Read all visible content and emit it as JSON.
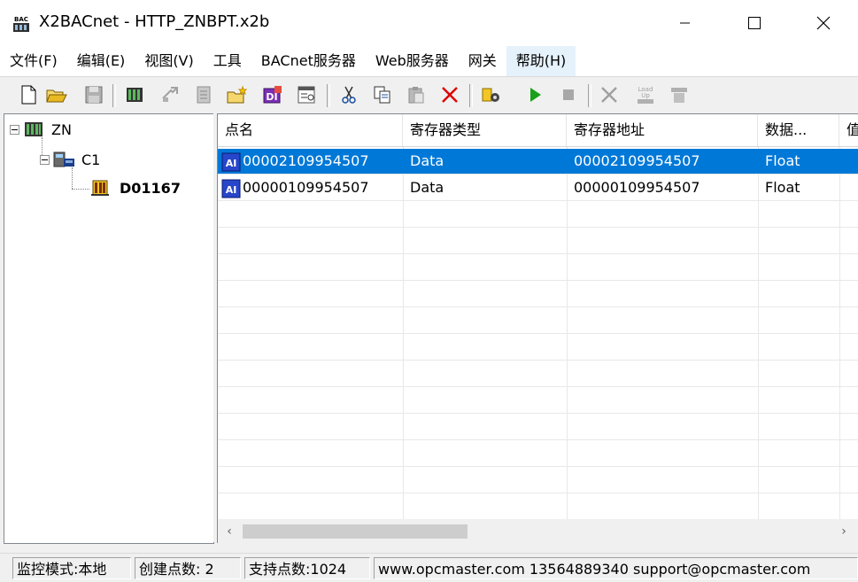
{
  "window": {
    "title": "X2BACnet - HTTP_ZNBPT.x2b",
    "minimize_icon": "minimize-icon",
    "maximize_icon": "maximize-icon",
    "close_icon": "close-icon"
  },
  "menu": {
    "items": [
      "文件(F)",
      "编辑(E)",
      "视图(V)",
      "工具",
      "BACnet服务器",
      "Web服务器",
      "网关",
      "帮助(H)"
    ]
  },
  "toolbar": {
    "icons": [
      "new-file-icon",
      "open-folder-icon",
      "save-icon",
      "device-icon",
      "export-icon",
      "list-icon",
      "add-folder-icon",
      "data-icon",
      "properties-icon",
      "cut-icon",
      "copy-icon",
      "paste-icon",
      "delete-icon",
      "config-icon",
      "run-icon",
      "stop-icon",
      "tools-icon",
      "load-up-icon",
      "download-icon"
    ],
    "load_up_label": "Load Up"
  },
  "tree": {
    "root": {
      "label": "ZN"
    },
    "child": {
      "label": "C1"
    },
    "leaf": {
      "label": "D01167"
    }
  },
  "list": {
    "columns": [
      "点名",
      "寄存器类型",
      "寄存器地址",
      "数据...",
      "值"
    ],
    "rows": [
      {
        "icon_text": "AI",
        "name": "00002109954507",
        "type": "Data",
        "address": "00002109954507",
        "datatype": "Float",
        "selected": true
      },
      {
        "icon_text": "AI",
        "name": "00000109954507",
        "type": "Data",
        "address": "00000109954507",
        "datatype": "Float",
        "selected": false
      }
    ],
    "scroll_left": "‹",
    "scroll_right": "›"
  },
  "status": {
    "mode": "监控模式:本地",
    "created": "创建点数:  2",
    "supported": "支持点数:1024",
    "contact": "www.opcmaster.com 13564889340 support@opcmaster.com"
  },
  "colors": {
    "selection": "#0078d7",
    "menu_hover": "#e5f1fb",
    "chrome": "#f0f0f0"
  }
}
